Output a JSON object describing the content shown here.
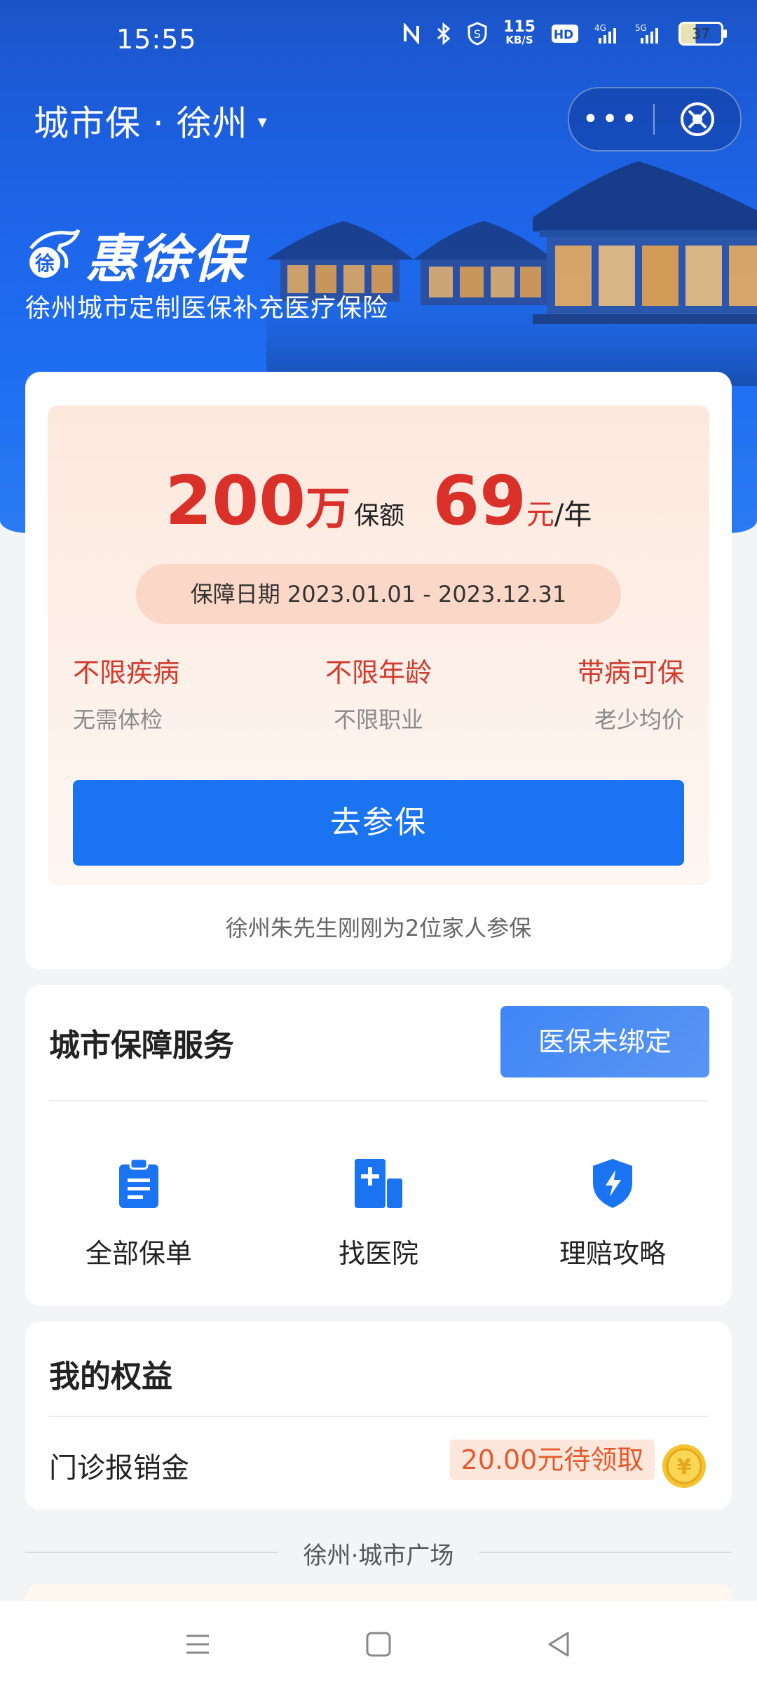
{
  "status_bar": {
    "time": "15:55",
    "speed": "115",
    "speed_unit": "KB/S",
    "battery": "37",
    "icons": [
      "nfc-icon",
      "bluetooth-icon",
      "security-icon",
      "hd-icon",
      "signal-4g-icon",
      "signal-5g-icon",
      "battery-icon"
    ]
  },
  "header": {
    "title": "城市保 · 徐州",
    "caret": "▾",
    "more": "•••"
  },
  "brand": {
    "logo_char": "徐",
    "name": "惠徐保",
    "subtitle": "徐州城市定制医保补充医疗保险"
  },
  "offer": {
    "coverage_amount": "200",
    "coverage_unit": "万",
    "coverage_label": "保额",
    "price": "69",
    "price_unit": "元",
    "price_period": "/年",
    "date_range": "保障日期 2023.01.01 - 2023.12.31",
    "features": [
      {
        "title": "不限疾病",
        "sub": "无需体检"
      },
      {
        "title": "不限年龄",
        "sub": "不限职业"
      },
      {
        "title": "带病可保",
        "sub": "老少均价"
      }
    ],
    "join_button": "去参保",
    "ticker": "徐州朱先生刚刚为2位家人参保"
  },
  "services": {
    "title": "城市保障服务",
    "bind_button": "医保未绑定",
    "items": [
      {
        "label": "全部保单",
        "icon": "clipboard-icon"
      },
      {
        "label": "找医院",
        "icon": "hospital-icon"
      },
      {
        "label": "理赔攻略",
        "icon": "shield-bolt-icon"
      }
    ]
  },
  "rights": {
    "title": "我的权益",
    "item_label": "门诊报销金",
    "item_value": "20.00元待领取",
    "coin_symbol": "¥"
  },
  "square": {
    "title": "徐州·城市广场"
  },
  "colors": {
    "primary": "#1a73f1",
    "accent_red": "#d9302a",
    "orange": "#e35b2c"
  }
}
